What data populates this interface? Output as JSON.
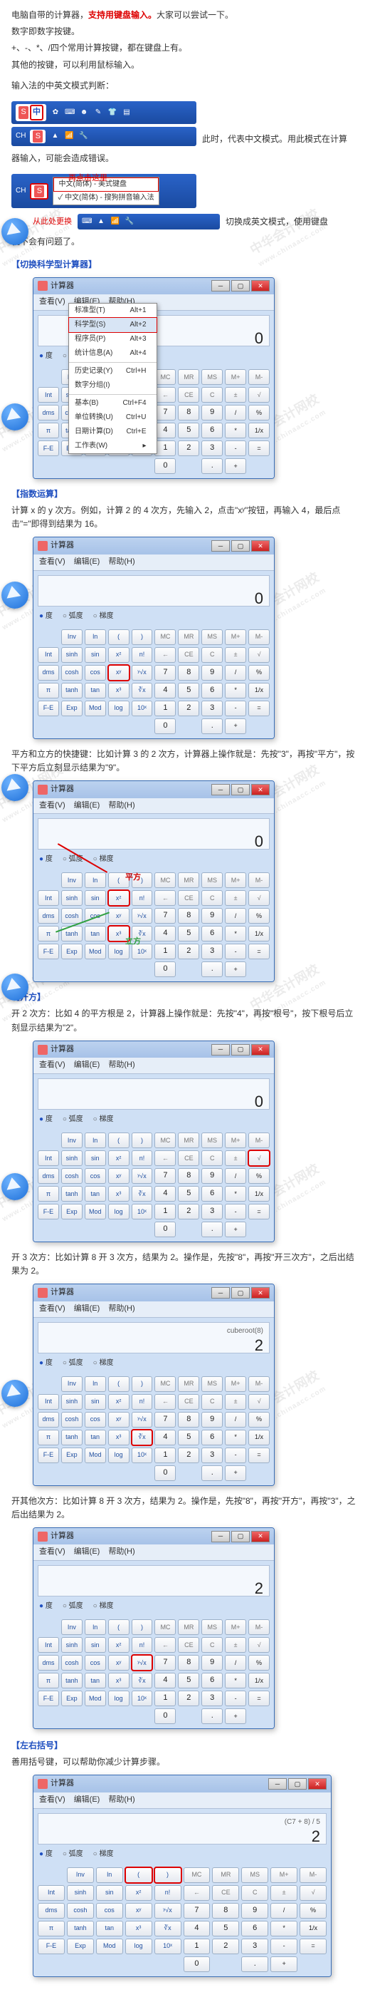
{
  "intro": {
    "p1a": "电脑自带的计算器，",
    "p1b": "支持用键盘输入。",
    "p1c": "大家可以尝试一下。",
    "p2": "数字即数字按键。",
    "p3": "+、-、*、/四个常用计算按键，都在键盘上有。",
    "p4": "其他的按键，可以利用鼠标输入。",
    "p5": "输入法的中英文模式判断：",
    "p6a": "此时，代表中文模式。用此模式在计算",
    "p6b": "器输入，可能会造成错误。",
    "p7a": "切换成英文模式，使用键盘",
    "p7b": "就不会有问题了。"
  },
  "ime": {
    "s_logo": "S",
    "zh_glyph": "中",
    "ch_label": "CH",
    "click_here": "再点击这里",
    "change_here": "从此处更换",
    "menu_item1": "中文(简体) - 美式键盘",
    "menu_item2": "中文(简体) - 搜狗拼音输入法"
  },
  "section_sci": {
    "title": "【切换科学型计算器】",
    "menu": {
      "std": "标准型(T)",
      "std_k": "Alt+1",
      "sci": "科学型(S)",
      "sci_k": "Alt+2",
      "prg": "程序员(P)",
      "prg_k": "Alt+3",
      "stat": "统计信息(A)",
      "stat_k": "Alt+4",
      "sep": "",
      "hist": "历史记录(Y)",
      "hist_k": "Ctrl+H",
      "grp": "数字分组(I)",
      "basic": "基本(B)",
      "basic_k": "Ctrl+F4",
      "unit": "单位转换(U)",
      "unit_k": "Ctrl+U",
      "date": "日期计算(D)",
      "date_k": "Ctrl+E",
      "ws": "工作表(W)"
    }
  },
  "section_exp": {
    "title": "【指数运算】",
    "p1": "计算 x 的 y 次方。例如，计算 2 的 4 次方，先输入 2，点击\"xʸ\"按钮，再输入 4，最后点击\"=\"即得到结果为 16。",
    "p2": "平方和立方的快捷键：比如计算 3 的 2 次方，计算器上操作就是：先按\"3\"，再按\"平方\"，按下平方后立刻显示结果为\"9\"。",
    "annot_sq": "平方",
    "annot_cb": "立方"
  },
  "section_root": {
    "title": "【开方】",
    "p1": "开 2 次方：比如 4 的平方根是 2，计算器上操作就是：先按\"4\"，再按\"根号\"，按下根号后立刻显示结果为\"2\"。",
    "p2": "开 3 次方：比如计算 8 开 3 次方，结果为 2。操作是，先按\"8\"，再按\"开三次方\"，之后出结果为 2。",
    "display2_small": "cuberoot(8)",
    "p3": "开其他次方：比如计算 8 开 3 次方，结果为 2。操作是，先按\"8\"，再按\"开方\"，再按\"3\"，之后出结果为 2。"
  },
  "section_paren": {
    "title": "【左右括号】",
    "p1": "善用括号键，可以帮助你减少计算步骤。",
    "display_small": "(C7 + 8) / 5"
  },
  "calc_common": {
    "title": "计算器",
    "view": "查看(V)",
    "edit": "编辑(E)",
    "help": "帮助(H)",
    "deg": "度",
    "rad": "弧度",
    "grad": "梯度",
    "display0": "0",
    "display2": "2"
  },
  "keys_row_mem": [
    "MC",
    "MR",
    "MS",
    "M+",
    "M-"
  ],
  "keys_row_top": [
    "←",
    "CE",
    "C",
    "±",
    "√"
  ],
  "keys_sci_col": [
    [
      "",
      "Inv",
      "ln",
      "(",
      ")"
    ],
    [
      "Int",
      "sinh",
      "sin",
      "x²",
      "n!"
    ],
    [
      "dms",
      "cosh",
      "cos",
      "xʸ",
      "ʸ√x"
    ],
    [
      "π",
      "tanh",
      "tan",
      "x³",
      "∛x"
    ],
    [
      "F-E",
      "Exp",
      "Mod",
      "log",
      "10ˣ"
    ]
  ],
  "keys_num_block": [
    [
      "7",
      "8",
      "9",
      "/",
      "%"
    ],
    [
      "4",
      "5",
      "6",
      "*",
      "1/x"
    ],
    [
      "1",
      "2",
      "3",
      "-",
      "="
    ],
    [
      "0",
      "",
      ".",
      "+",
      ""
    ]
  ],
  "wm": {
    "brand": "中华会计网校",
    "url": "www.chinaacc.com"
  }
}
